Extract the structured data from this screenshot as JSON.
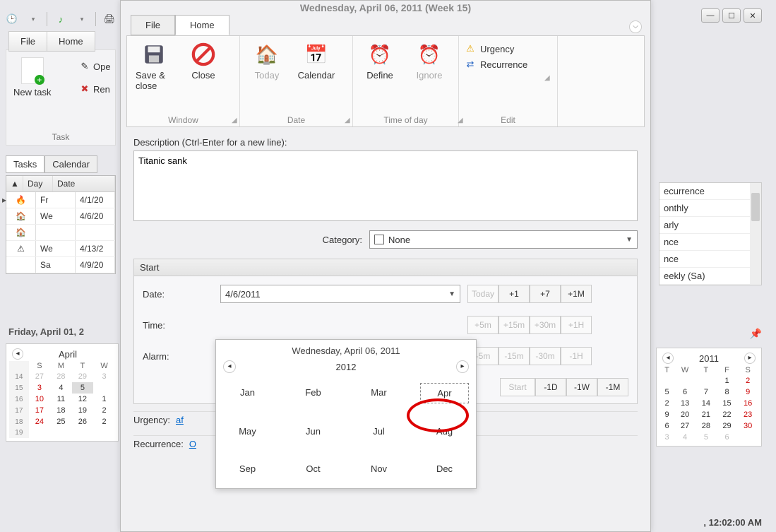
{
  "window": {
    "title": "Wednesday, April 06, 2011 (Week 15)"
  },
  "back": {
    "menu": {
      "file": "File",
      "home": "Home"
    },
    "ribbon": {
      "new_task": "New task",
      "open": "Ope",
      "remove": "Ren",
      "group": "Task"
    },
    "tabs": {
      "tasks": "Tasks",
      "calendar": "Calendar"
    },
    "grid": {
      "headers": {
        "day": "Day",
        "date": "Date"
      },
      "rows": [
        {
          "icon": "🔥",
          "day": "Fr",
          "date": "4/1/20",
          "marker": "▸"
        },
        {
          "icon": "🏠",
          "day": "We",
          "date": "4/6/20",
          "marker": ""
        },
        {
          "icon": "🏠",
          "day": "",
          "date": "",
          "marker": ""
        },
        {
          "icon": "⚠",
          "day": "We",
          "date": "4/13/2",
          "marker": ""
        },
        {
          "icon": "",
          "day": "Sa",
          "date": "4/9/20",
          "marker": ""
        }
      ]
    },
    "calendar_title": "Friday, April 01, 2",
    "mini_left": {
      "month": "April",
      "dow": [
        "S",
        "M",
        "T",
        "W"
      ],
      "weeks": [
        {
          "wk": "14",
          "cells": [
            {
              "v": "27",
              "dim": true
            },
            {
              "v": "28",
              "dim": true
            },
            {
              "v": "29",
              "dim": true
            },
            {
              "v": "3",
              "dim": true
            }
          ]
        },
        {
          "wk": "15",
          "cells": [
            {
              "v": "3",
              "red": true
            },
            {
              "v": "4"
            },
            {
              "v": "5",
              "sel": true
            },
            {
              "v": ""
            }
          ]
        },
        {
          "wk": "16",
          "cells": [
            {
              "v": "10",
              "red": true
            },
            {
              "v": "11"
            },
            {
              "v": "12"
            },
            {
              "v": "1"
            }
          ]
        },
        {
          "wk": "17",
          "cells": [
            {
              "v": "17",
              "red": true
            },
            {
              "v": "18"
            },
            {
              "v": "19"
            },
            {
              "v": "2"
            }
          ]
        },
        {
          "wk": "18",
          "cells": [
            {
              "v": "24",
              "red": true
            },
            {
              "v": "25"
            },
            {
              "v": "26"
            },
            {
              "v": "2"
            }
          ]
        },
        {
          "wk": "19",
          "cells": [
            {
              "v": ""
            },
            {
              "v": ""
            },
            {
              "v": ""
            },
            {
              "v": ""
            }
          ]
        }
      ]
    },
    "recurrence_list": [
      "ecurrence",
      "onthly",
      "arly",
      "nce",
      "nce",
      "eekly (Sa)"
    ],
    "mini_right": {
      "year": "2011",
      "dow": [
        "T",
        "W",
        "T",
        "F",
        "S"
      ],
      "rows": [
        [
          {
            "v": ""
          },
          {
            "v": ""
          },
          {
            "v": ""
          },
          {
            "v": "1"
          },
          {
            "v": "2",
            "red": true
          }
        ],
        [
          {
            "v": "5"
          },
          {
            "v": "6"
          },
          {
            "v": "7"
          },
          {
            "v": "8"
          },
          {
            "v": "9",
            "red": true
          }
        ],
        [
          {
            "v": "2"
          },
          {
            "v": "13"
          },
          {
            "v": "14"
          },
          {
            "v": "15"
          },
          {
            "v": "16",
            "red": true
          }
        ],
        [
          {
            "v": "9"
          },
          {
            "v": "20"
          },
          {
            "v": "21"
          },
          {
            "v": "22"
          },
          {
            "v": "23",
            "red": true
          }
        ],
        [
          {
            "v": "6"
          },
          {
            "v": "27"
          },
          {
            "v": "28"
          },
          {
            "v": "29"
          },
          {
            "v": "30",
            "red": true
          }
        ],
        [
          {
            "v": "3",
            "dim": true
          },
          {
            "v": "4",
            "dim": true
          },
          {
            "v": "5",
            "dim": true
          },
          {
            "v": "6",
            "dim": true
          },
          {
            "v": ""
          }
        ]
      ]
    },
    "status": ", 12:02:00 AM"
  },
  "dialog": {
    "tabs": {
      "file": "File",
      "home": "Home"
    },
    "ribbon": {
      "window": {
        "save_close": "Save & close",
        "close": "Close",
        "group": "Window"
      },
      "date": {
        "today": "Today",
        "calendar": "Calendar",
        "group": "Date"
      },
      "tod": {
        "define": "Define",
        "ignore": "Ignore",
        "group": "Time of day"
      },
      "edit": {
        "urgency": "Urgency",
        "recurrence": "Recurrence",
        "group": "Edit"
      }
    },
    "desc_label": "Description (Ctrl-Enter for a new line):",
    "desc_value": "Titanic sank",
    "category_label": "Category:",
    "category_value": "None",
    "start": {
      "title": "Start",
      "date_label": "Date:",
      "date_value": "4/6/2011",
      "date_quick": [
        "Today",
        "+1",
        "+7",
        "+1M"
      ],
      "time_label": "Time:",
      "time_quick_top": [
        "+5m",
        "+15m",
        "+30m",
        "+1H"
      ],
      "alarm_label": "Alarm:",
      "alarm_quick": [
        "-5m",
        "-15m",
        "-30m",
        "-1H"
      ],
      "start_quick": [
        "Start",
        "-1D",
        "-1W",
        "-1M"
      ]
    },
    "urgency_label": "Urgency:",
    "urgency_value": "af",
    "recurrence_label": "Recurrence:",
    "recurrence_value": "O"
  },
  "datepicker": {
    "title": "Wednesday, April 06, 2011",
    "year": "2012",
    "months": [
      "Jan",
      "Feb",
      "Mar",
      "Apr",
      "May",
      "Jun",
      "Jul",
      "Aug",
      "Sep",
      "Oct",
      "Nov",
      "Dec"
    ],
    "selected": "Apr"
  }
}
